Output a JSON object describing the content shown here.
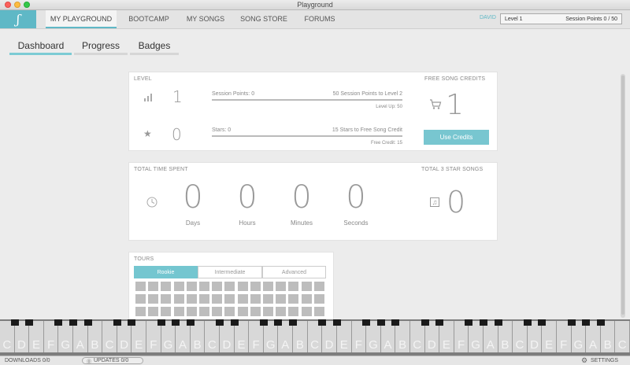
{
  "window": {
    "title": "Playground"
  },
  "nav": {
    "logo_symbol": "ʃ",
    "tabs": [
      "MY PLAYGROUND",
      "BOOTCAMP",
      "MY SONGS",
      "SONG STORE",
      "FORUMS"
    ],
    "active_tab": "MY PLAYGROUND",
    "user": "DAVID",
    "level": "Level 1",
    "session_points": "Session Points 0 / 50"
  },
  "subtabs": [
    "Dashboard",
    "Progress",
    "Badges"
  ],
  "active_subtab": "Dashboard",
  "level_card": {
    "title": "LEVEL",
    "level_value": "1",
    "stars_value": "0",
    "session_points_label": "Session Points: 0",
    "session_points_target": "50 Session Points to Level 2",
    "level_up_note": "Level Up: 50",
    "stars_label": "Stars: 0",
    "stars_target": "15 Stars to Free Song Credit",
    "free_credit_note": "Free Credit: 15",
    "credits_title": "FREE SONG CREDITS",
    "credits_value": "1",
    "use_credits_label": "Use Credits"
  },
  "time_card": {
    "title": "TOTAL TIME SPENT",
    "units": [
      {
        "value": "0",
        "label": "Days"
      },
      {
        "value": "0",
        "label": "Hours"
      },
      {
        "value": "0",
        "label": "Minutes"
      },
      {
        "value": "0",
        "label": "Seconds"
      }
    ],
    "three_star_title": "TOTAL 3 STAR SONGS",
    "three_star_value": "0"
  },
  "tours": {
    "title": "TOURS",
    "tabs": [
      "Rookie",
      "Intermediate",
      "Advanced"
    ],
    "active_tab": "Rookie"
  },
  "piano": {
    "white_keys": [
      "C",
      "D",
      "E",
      "F",
      "G",
      "A",
      "B",
      "C",
      "D",
      "E",
      "F",
      "G",
      "A",
      "B",
      "C",
      "D",
      "E",
      "F",
      "G",
      "A",
      "B",
      "C",
      "D",
      "E",
      "F",
      "G",
      "A",
      "B",
      "C",
      "D",
      "E",
      "F",
      "G",
      "A",
      "B",
      "C",
      "D",
      "E",
      "F",
      "G",
      "A",
      "B",
      "C"
    ]
  },
  "bottom_bar": {
    "downloads": "DOWNLOADS 0/0",
    "updates": "UPDATES 0/0",
    "settings": "SETTINGS"
  },
  "colors": {
    "accent": "#5fb8c6",
    "accent_button": "#78c6d0",
    "active_tab_fill": "#74c6d0"
  }
}
